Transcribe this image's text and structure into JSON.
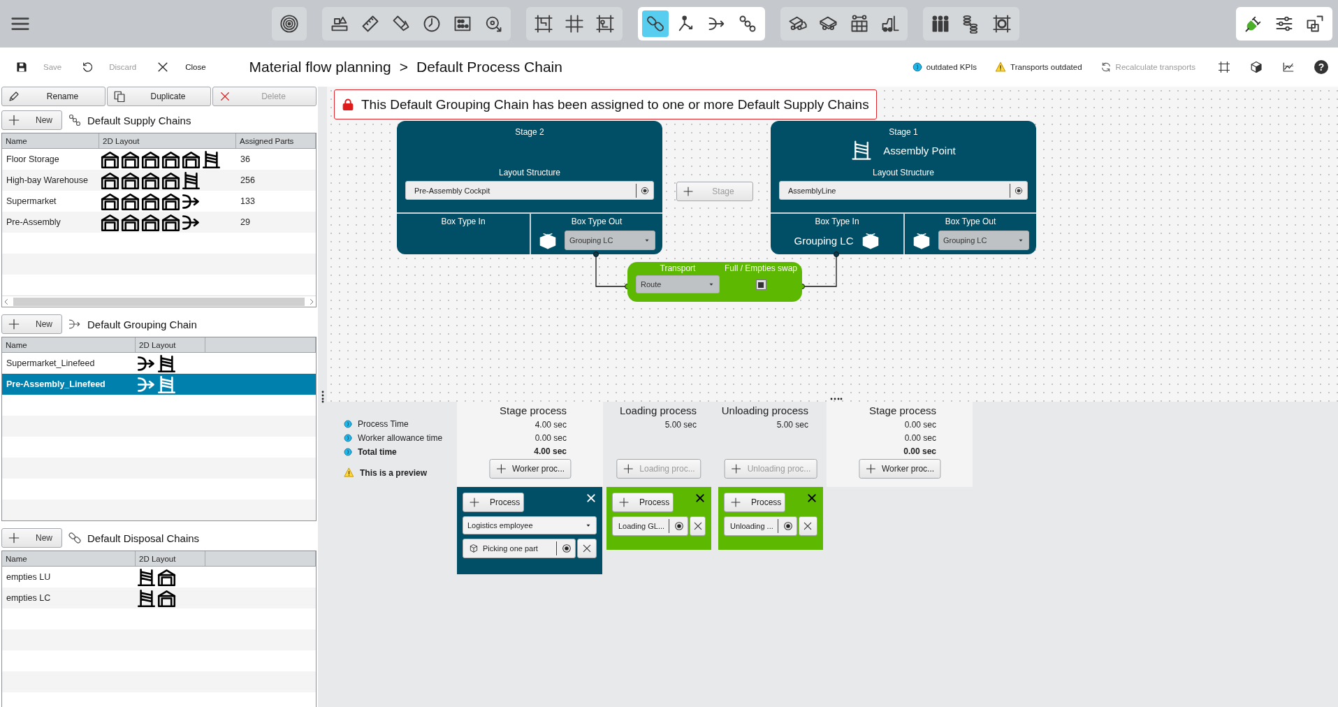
{
  "toolbar": {
    "groups": [
      {
        "highlighted": false,
        "tools": [
          {
            "selected": false
          }
        ]
      },
      {
        "highlighted": false,
        "tools": [
          {
            "selected": false
          },
          {
            "selected": false
          },
          {
            "selected": false
          },
          {
            "selected": false
          },
          {
            "selected": false
          },
          {
            "selected": false
          }
        ]
      },
      {
        "highlighted": false,
        "tools": [
          {
            "selected": false
          },
          {
            "selected": false
          },
          {
            "selected": false
          }
        ]
      },
      {
        "highlighted": true,
        "tools": [
          {
            "selected": true
          },
          {
            "selected": false
          },
          {
            "selected": false
          },
          {
            "selected": false
          }
        ]
      },
      {
        "highlighted": false,
        "tools": [
          {
            "selected": false
          },
          {
            "selected": false
          },
          {
            "selected": false
          },
          {
            "selected": false
          }
        ]
      },
      {
        "highlighted": false,
        "tools": [
          {
            "selected": false
          },
          {
            "selected": false
          },
          {
            "selected": false
          }
        ]
      }
    ],
    "right_group": {
      "highlighted": true,
      "tools": [
        {
          "selected": false
        },
        {
          "selected": false
        },
        {
          "selected": false
        }
      ]
    }
  },
  "actions": [
    {
      "label": "Save",
      "disabled": true
    },
    {
      "label": "Discard",
      "disabled": true
    },
    {
      "label": "Close",
      "disabled": false
    }
  ],
  "breadcrumb": {
    "items": [
      "Material flow planning",
      "Default Process Chain"
    ],
    "separator": ">"
  },
  "status": {
    "kpi": "outdated KPIs",
    "transports": "Transports outdated",
    "recalculate": {
      "label": "Recalculate transports",
      "disabled": true
    },
    "help": "?"
  },
  "left_panel": {
    "edit_buttons": [
      {
        "label": "Rename",
        "disabled": false
      },
      {
        "label": "Duplicate",
        "disabled": false
      },
      {
        "label": "Delete",
        "disabled": true
      }
    ],
    "sections": [
      {
        "new_button": "New",
        "title": "Default Supply Chains",
        "columns": [
          "Name",
          "2D Layout",
          "Assigned Parts"
        ],
        "scrollbar": true,
        "rows": [
          {
            "name": "Floor Storage",
            "layout": [
              {
                "kind": "warehouse"
              },
              {
                "kind": "warehouse"
              },
              {
                "kind": "warehouse"
              },
              {
                "kind": "warehouse"
              },
              {
                "kind": "warehouse"
              },
              {
                "kind": "rack"
              }
            ],
            "parts": "36",
            "selected": false
          },
          {
            "name": "High-bay Warehouse",
            "layout": [
              {
                "kind": "warehouse"
              },
              {
                "kind": "warehouse"
              },
              {
                "kind": "warehouse"
              },
              {
                "kind": "warehouse"
              },
              {
                "kind": "rack"
              }
            ],
            "parts": "256",
            "selected": false
          },
          {
            "name": "Supermarket",
            "layout": [
              {
                "kind": "warehouse"
              },
              {
                "kind": "warehouse"
              },
              {
                "kind": "warehouse"
              },
              {
                "kind": "warehouse"
              },
              {
                "kind": "flow"
              }
            ],
            "parts": "133",
            "selected": false
          },
          {
            "name": "Pre-Assembly",
            "layout": [
              {
                "kind": "warehouse"
              },
              {
                "kind": "warehouse"
              },
              {
                "kind": "warehouse"
              },
              {
                "kind": "warehouse"
              },
              {
                "kind": "flow"
              }
            ],
            "parts": "29",
            "selected": false
          }
        ]
      },
      {
        "new_button": "New",
        "title": "Default Grouping Chain",
        "columns": [
          "Name",
          "2D Layout"
        ],
        "scrollbar": false,
        "rows": [
          {
            "name": "Supermarket_Linefeed",
            "layout": [
              {
                "kind": "flow"
              },
              {
                "kind": "rack"
              }
            ],
            "selected": false
          },
          {
            "name": "Pre-Assembly_Linefeed",
            "layout": [
              {
                "kind": "flow"
              },
              {
                "kind": "rack"
              }
            ],
            "selected": true
          }
        ]
      },
      {
        "new_button": "New",
        "title": "Default Disposal Chains",
        "columns": [
          "Name",
          "2D Layout"
        ],
        "scrollbar": false,
        "rows": [
          {
            "name": "empties LU",
            "layout": [
              {
                "kind": "rack"
              },
              {
                "kind": "warehouse"
              }
            ],
            "selected": false
          },
          {
            "name": "empties LC",
            "layout": [
              {
                "kind": "rack"
              },
              {
                "kind": "warehouse"
              }
            ],
            "selected": false
          }
        ]
      }
    ]
  },
  "canvas": {
    "notice": "This Default Grouping Chain has been assigned to one or more Default Supply Chains",
    "stages": [
      {
        "title": "Stage 2",
        "layout_label": "Layout Structure",
        "layout_value": "Pre-Assembly Cockpit",
        "box_in_label": "Box Type In",
        "box_out_label": "Box Type Out",
        "box_out_value": "Grouping LC"
      },
      {
        "title": "Stage 1",
        "name": "Assembly Point",
        "layout_label": "Layout Structure",
        "layout_value": "AssemblyLine",
        "box_in_label": "Box Type In",
        "box_in_value": "Grouping LC",
        "box_out_label": "Box Type Out",
        "box_out_value": "Grouping LC"
      }
    ],
    "add_stage": {
      "label": "Stage",
      "disabled": true
    },
    "transport": {
      "title": "Transport",
      "mode": "Route",
      "swap_label": "Full / Empties swap",
      "swap_checked": true
    }
  },
  "process": {
    "legend": [
      {
        "label": "Process Time",
        "kind": "time"
      },
      {
        "label": "Worker allowance time",
        "kind": "time"
      },
      {
        "label": "Total time",
        "kind": "total"
      }
    ],
    "preview": "This is a preview",
    "columns": [
      {
        "kind": "stage",
        "title": "Stage process",
        "values": [
          "4.00 sec",
          "0.00 sec",
          "4.00 sec"
        ],
        "button": {
          "label": "Worker proc...",
          "disabled": false
        }
      },
      {
        "kind": "transfer",
        "title": "Loading process",
        "values": [
          "5.00 sec"
        ],
        "button": {
          "label": "Loading proc...",
          "disabled": true
        }
      },
      {
        "kind": "transfer",
        "title": "Unloading process",
        "values": [
          "5.00 sec"
        ],
        "button": {
          "label": "Unloading proc...",
          "disabled": true
        }
      },
      {
        "kind": "stage",
        "title": "Stage process",
        "values": [
          "0.00 sec",
          "0.00 sec",
          "0.00 sec"
        ],
        "button": {
          "label": "Worker proc...",
          "disabled": false
        }
      }
    ],
    "cards": [
      {
        "kind": "stage",
        "add_label": "Process",
        "worker": "Logistics employee",
        "items": [
          {
            "label": "Picking one part",
            "kind": "part"
          }
        ]
      },
      {
        "kind": "transfer",
        "add_label": "Process",
        "items": [
          {
            "label": "Loading GL...",
            "kind": "plain"
          }
        ]
      },
      {
        "kind": "transfer",
        "add_label": "Process",
        "items": [
          {
            "label": "Unloading ...",
            "kind": "plain"
          }
        ]
      }
    ]
  }
}
